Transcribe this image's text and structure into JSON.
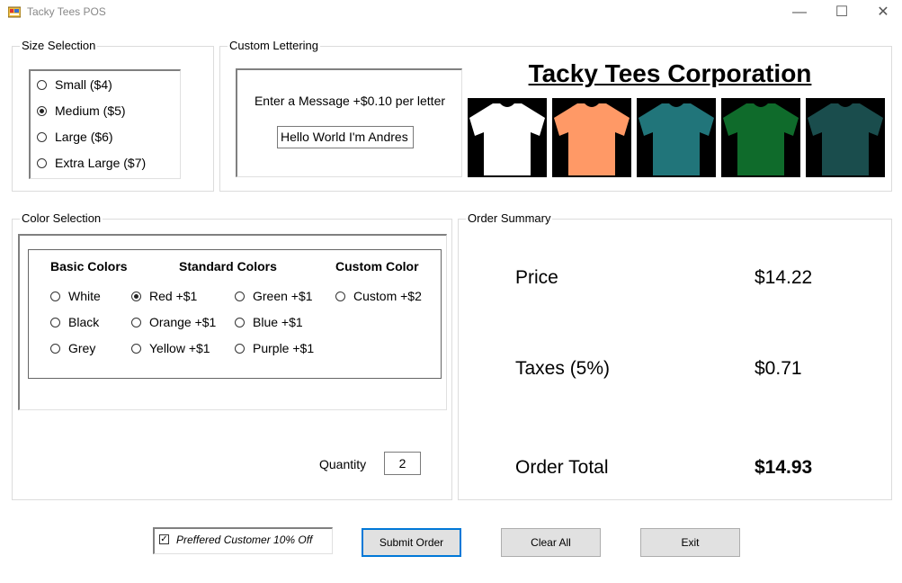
{
  "window": {
    "title": "Tacky Tees POS",
    "controls": [
      "minimize-icon",
      "maximize-icon",
      "close-icon"
    ]
  },
  "size_selection": {
    "label": "Size Selection",
    "options": [
      {
        "label": "Small ($4)",
        "checked": false
      },
      {
        "label": "Medium ($5)",
        "checked": true
      },
      {
        "label": "Large ($6)",
        "checked": false
      },
      {
        "label": "Extra Large ($7)",
        "checked": false
      }
    ]
  },
  "custom_lettering": {
    "label": "Custom Lettering",
    "prompt": "Enter a Message +$0.10 per letter",
    "message": "Hello World I'm Andres"
  },
  "brand": {
    "title": "Tacky Tees Corporation",
    "shirt_colors": [
      "#ffffff",
      "#ff9966",
      "#21757a",
      "#0f6b2b",
      "#1a4d4d"
    ]
  },
  "color_selection": {
    "label": "Color Selection",
    "basic": {
      "heading": "Basic Colors",
      "options": [
        {
          "label": "White",
          "checked": false
        },
        {
          "label": "Black",
          "checked": false
        },
        {
          "label": "Grey",
          "checked": false
        }
      ]
    },
    "standard": {
      "heading": "Standard Colors",
      "col1": [
        {
          "label": "Red +$1",
          "checked": true
        },
        {
          "label": "Orange +$1",
          "checked": false
        },
        {
          "label": "Yellow +$1",
          "checked": false
        }
      ],
      "col2": [
        {
          "label": "Green +$1",
          "checked": false
        },
        {
          "label": "Blue +$1",
          "checked": false
        },
        {
          "label": "Purple +$1",
          "checked": false
        }
      ]
    },
    "custom": {
      "heading": "Custom Color",
      "options": [
        {
          "label": "Custom +$2",
          "checked": false
        }
      ]
    },
    "quantity_label": "Quantity",
    "quantity": "2"
  },
  "order_summary": {
    "label": "Order Summary",
    "price_label": "Price",
    "price": "$14.22",
    "taxes_label": "Taxes (5%)",
    "taxes": "$0.71",
    "total_label": "Order Total",
    "total": "$14.93"
  },
  "footer": {
    "preferred_label": "Preffered Customer 10% Off",
    "preferred_checked": true,
    "submit": "Submit Order",
    "clear": "Clear All",
    "exit": "Exit"
  }
}
